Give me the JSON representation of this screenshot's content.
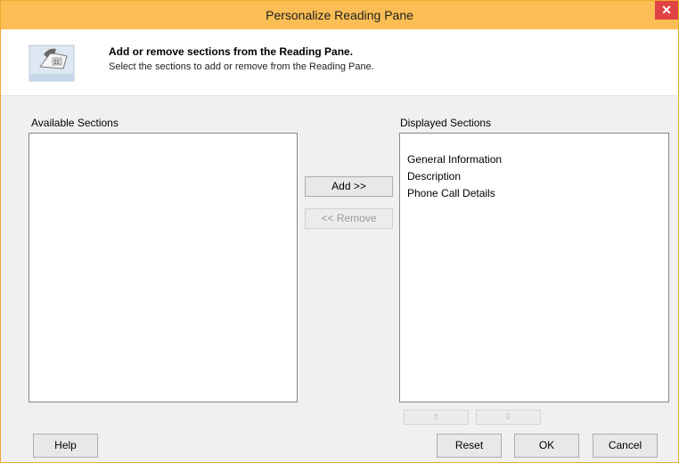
{
  "window": {
    "title": "Personalize Reading Pane",
    "close_glyph": "✕"
  },
  "header": {
    "icon": "phone-call-icon",
    "title": "Add or remove sections from the Reading Pane.",
    "subtitle": "Select the sections to add or remove from the Reading Pane."
  },
  "available": {
    "label": "Available Sections",
    "items": []
  },
  "displayed": {
    "label": "Displayed Sections",
    "items": [
      "General Information",
      "Description",
      "Phone Call Details"
    ]
  },
  "buttons": {
    "add": "Add >>",
    "remove": "<< Remove",
    "move_up": "⇧",
    "move_down": "⇩",
    "help": "Help",
    "reset": "Reset",
    "ok": "OK",
    "cancel": "Cancel"
  },
  "colors": {
    "titlebar": "#fbbe54",
    "close": "#e04343",
    "dialog_bg": "#f0f0f0"
  }
}
